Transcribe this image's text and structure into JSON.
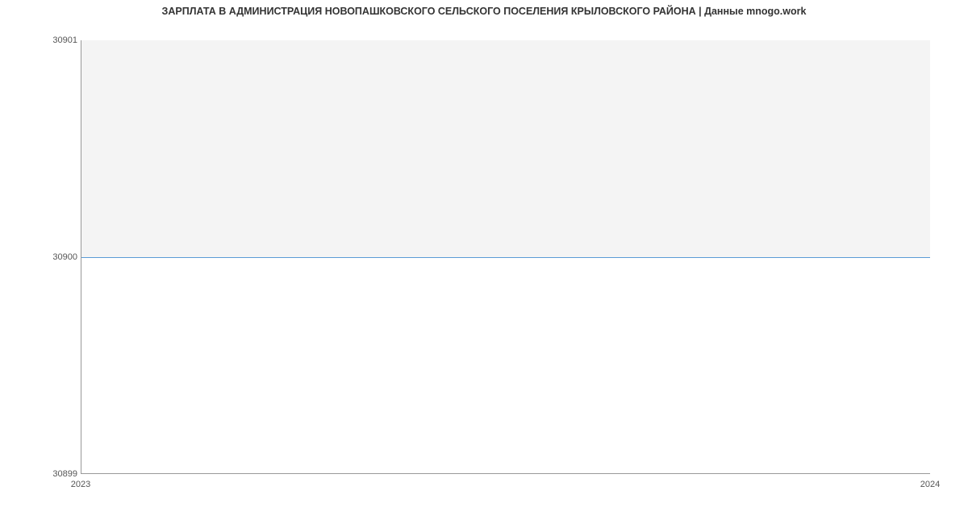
{
  "chart_data": {
    "type": "area",
    "title": "ЗАРПЛАТА В АДМИНИСТРАЦИЯ НОВОПАШКОВСКОГО СЕЛЬСКОГО ПОСЕЛЕНИЯ КРЫЛОВСКОГО РАЙОНА | Данные mnogo.work",
    "xlabel": "",
    "ylabel": "",
    "ylim": [
      30899,
      30901
    ],
    "x": [
      2023,
      2024
    ],
    "values": [
      30900,
      30900
    ],
    "y_ticks": [
      "30901",
      "30900",
      "30899"
    ],
    "x_ticks": [
      "2023",
      "2024"
    ],
    "line_color": "#5b9bd5",
    "fill_color": "#f4f4f4"
  }
}
